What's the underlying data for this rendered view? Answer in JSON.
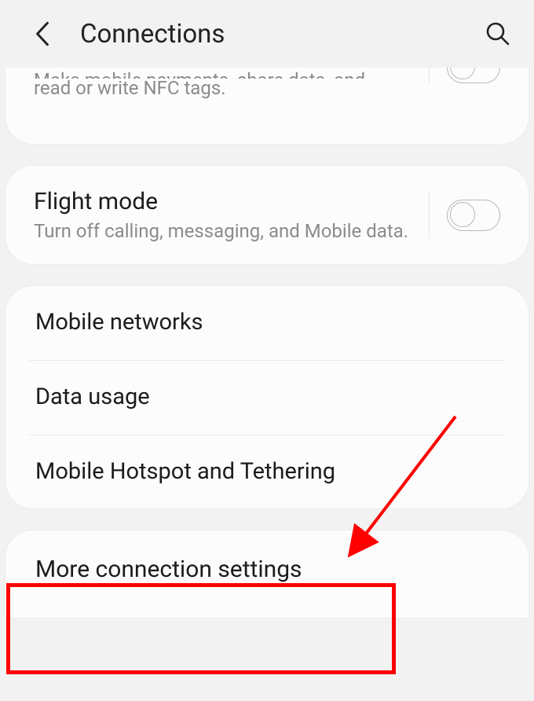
{
  "header": {
    "title": "Connections"
  },
  "nfc": {
    "partial_line1": "Make mobile payments, share data, and",
    "partial_line2": "read or write NFC tags.",
    "toggle_on": false
  },
  "flight_mode": {
    "title": "Flight mode",
    "subtitle": "Turn off calling, messaging, and Mobile data.",
    "toggle_on": false
  },
  "list": {
    "mobile_networks": "Mobile networks",
    "data_usage": "Data usage",
    "hotspot": "Mobile Hotspot and Tethering"
  },
  "more": {
    "title": "More connection settings"
  }
}
